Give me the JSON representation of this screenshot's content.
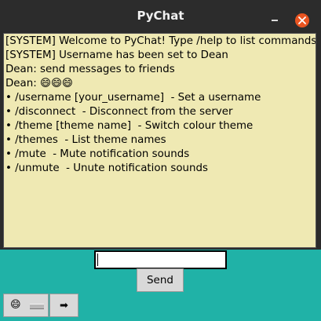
{
  "window": {
    "title": "PyChat"
  },
  "chat": {
    "lines": [
      "[SYSTEM] Welcome to PyChat! Type /help to list commands",
      "[SYSTEM] Username has been set to Dean",
      "Dean: send messages to friends",
      "Dean: 😄😄😄",
      "• /username [your_username]  - Set a username",
      "• /disconnect  - Disconnect from the server",
      "• /theme [theme name]  - Switch colour theme",
      "• /themes  - List theme names",
      "• /mute  - Mute notification sounds",
      "• /unmute  - Unute notification sounds"
    ]
  },
  "input": {
    "value": ""
  },
  "buttons": {
    "send_label": "Send",
    "emoji_label": "😄",
    "arrow_label": "➡"
  },
  "colors": {
    "chat_background": "#efe9b3",
    "bottom_background": "#20b2a7",
    "close_button": "#e95420"
  }
}
